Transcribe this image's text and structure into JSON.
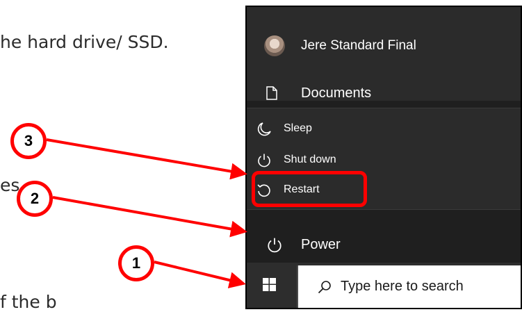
{
  "document": {
    "line1": "he hard drive/ SSD.",
    "line2": "es",
    "line3": "f      the   b"
  },
  "start_menu": {
    "user_name": "Jere Standard Final",
    "documents_label": "Documents",
    "power_options": [
      {
        "label": "Sleep",
        "icon": "moon-icon"
      },
      {
        "label": "Shut down",
        "icon": "power-icon"
      },
      {
        "label": "Restart",
        "icon": "restart-icon"
      }
    ],
    "power_label": "Power"
  },
  "taskbar": {
    "search_placeholder": "Type here to search"
  },
  "callouts": {
    "one": "1",
    "two": "2",
    "three": "3"
  },
  "colors": {
    "annotation": "#ff0000",
    "menu_bg": "#1f1f1f",
    "flyout_bg": "#2b2b2b"
  }
}
